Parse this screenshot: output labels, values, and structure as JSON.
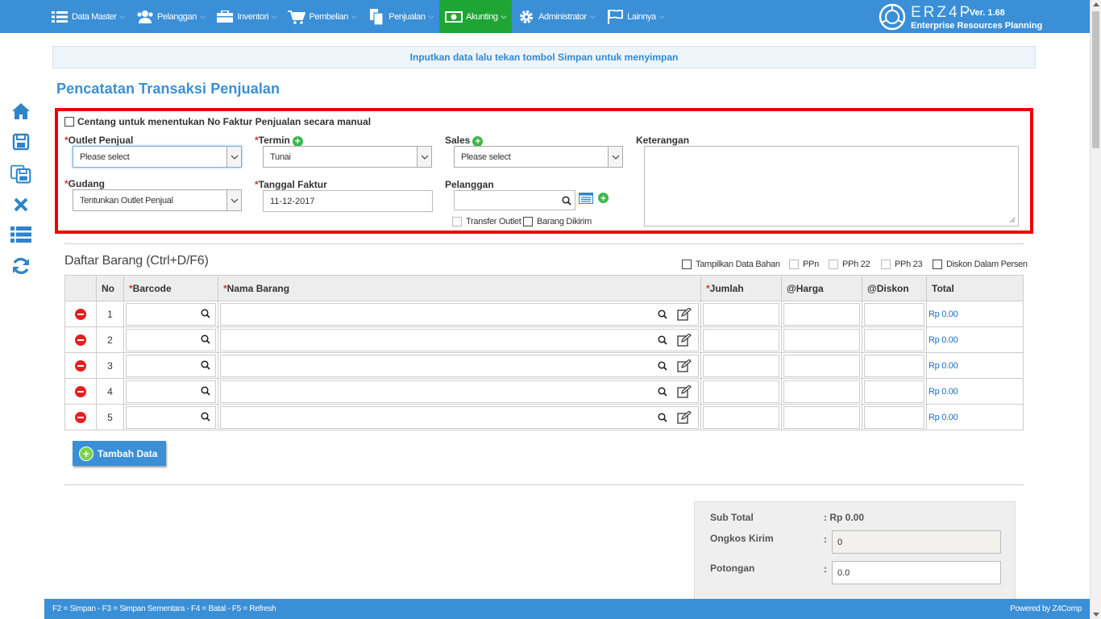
{
  "nav": {
    "items": [
      {
        "label": "Data Master",
        "icon": "list-icon"
      },
      {
        "label": "Pelanggan",
        "icon": "users-icon"
      },
      {
        "label": "Inventori",
        "icon": "inventory-icon"
      },
      {
        "label": "Pembelian",
        "icon": "cart-icon"
      },
      {
        "label": "Penjualan",
        "icon": "document-icon"
      },
      {
        "label": "Akunting",
        "icon": "money-icon"
      },
      {
        "label": "Administrator",
        "icon": "gear-icon"
      },
      {
        "label": "Lainnya",
        "icon": "flag-icon"
      }
    ],
    "active": "Akunting",
    "accent": "#3a8fd6",
    "active_color": "#1ea534"
  },
  "brand": {
    "name": "ERZ4P",
    "version": "- Ver. 1.68",
    "subtitle": "Enterprise Resources Planning"
  },
  "sidebar": {
    "icons": [
      "home-icon",
      "save-icon",
      "save-all-icon",
      "cancel-icon",
      "list-icon",
      "refresh-icon"
    ]
  },
  "info_message": "Inputkan data lalu tekan tombol Simpan untuk menyimpan",
  "page_title": "Pencatatan Transaksi Penjualan",
  "form": {
    "manual_invoice_label": "Centang untuk menentukan No Faktur Penjualan secara manual",
    "outlet_label": "Outlet Penjual",
    "outlet_value": "Please select",
    "termin_label": "Termin",
    "termin_value": "Tunai",
    "sales_label": "Sales",
    "sales_value": "Please select",
    "keterangan_label": "Keterangan",
    "gudang_label": "Gudang",
    "gudang_value": "Tentunkan Outlet Penjual",
    "tanggal_label": "Tanggal Faktur",
    "tanggal_value": "11-12-2017",
    "pelanggan_label": "Pelanggan",
    "pelanggan_value": "",
    "transfer_outlet_label": "Transfer Outlet",
    "barang_dikirim_label": "Barang Dikirim",
    "required_mark": "*"
  },
  "items_section": {
    "title": "Daftar Barang (Ctrl+D/F6)",
    "options": {
      "tampilkan": "Tampilkan Data Bahan",
      "ppn": "PPn",
      "pph22": "PPh 22",
      "pph23": "PPh 23",
      "diskon_persen": "Diskon Dalam Persen"
    },
    "columns": {
      "no": "No",
      "barcode": "Barcode",
      "nama": "Nama Barang",
      "jumlah": "Jumlah",
      "harga": "@Harga",
      "diskon": "@Diskon",
      "total": "Total"
    },
    "rows": [
      {
        "no": "1",
        "total": "Rp 0.00"
      },
      {
        "no": "2",
        "total": "Rp 0.00"
      },
      {
        "no": "3",
        "total": "Rp 0.00"
      },
      {
        "no": "4",
        "total": "Rp 0.00"
      },
      {
        "no": "5",
        "total": "Rp 0.00"
      }
    ],
    "add_button": "Tambah Data"
  },
  "summary": {
    "subtotal_label": "Sub Total",
    "subtotal_value": "Rp 0.00",
    "ongkos_label": "Ongkos Kirim",
    "ongkos_value": "0",
    "potongan_label": "Potongan",
    "potongan_value": "0.0",
    "colon": ":"
  },
  "footer": {
    "shortcuts": "F2 = Simpan - F3 = Simpan Sementara - F4 = Batal - F5 = Refresh",
    "powered": "Powered by Z4Comp"
  }
}
